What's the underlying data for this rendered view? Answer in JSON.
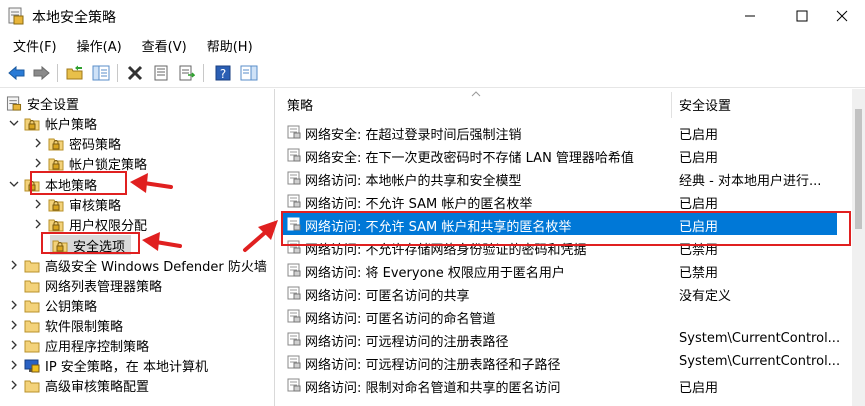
{
  "window": {
    "title": "本地安全策略"
  },
  "menu": [
    "文件(F)",
    "操作(A)",
    "查看(V)",
    "帮助(H)"
  ],
  "toolbar": {
    "buttons": [
      "back-icon",
      "forward-icon",
      "up-folder-icon",
      "show-tree-icon",
      "delete-icon",
      "properties-icon",
      "export-list-icon",
      "help-icon",
      "action-pane-icon"
    ]
  },
  "tree": {
    "root": "安全设置",
    "account_policy": "帐户策略",
    "password_policy": "密码策略",
    "lockout_policy": "帐户锁定策略",
    "local_policy": "本地策略",
    "audit_policy": "审核策略",
    "user_rights": "用户权限分配",
    "security_options": "安全选项",
    "firewall": "高级安全 Windows Defender 防火墙",
    "network_list": "网络列表管理器策略",
    "public_key": "公钥策略",
    "software_restriction": "软件限制策略",
    "app_control": "应用程序控制策略",
    "ip_security": "IP 安全策略，在 本地计算机",
    "advanced_audit": "高级审核策略配置"
  },
  "list": {
    "header_policy": "策略",
    "header_setting": "安全设置",
    "rows": [
      {
        "policy": "网络安全: 在超过登录时间后强制注销",
        "setting": "已启用"
      },
      {
        "policy": "网络安全: 在下一次更改密码时不存储 LAN 管理器哈希值",
        "setting": "已启用"
      },
      {
        "policy": "网络访问: 本地帐户的共享和安全模型",
        "setting": "经典 - 对本地用户进行..."
      },
      {
        "policy": "网络访问: 不允许 SAM 帐户的匿名枚举",
        "setting": "已启用"
      },
      {
        "policy": "网络访问: 不允许 SAM 帐户和共享的匿名枚举",
        "setting": "已启用"
      },
      {
        "policy": "网络访问: 不允许存储网络身份验证的密码和凭据",
        "setting": "已禁用"
      },
      {
        "policy": "网络访问: 将 Everyone 权限应用于匿名用户",
        "setting": "已禁用"
      },
      {
        "policy": "网络访问: 可匿名访问的共享",
        "setting": "没有定义"
      },
      {
        "policy": "网络访问: 可匿名访问的命名管道",
        "setting": ""
      },
      {
        "policy": "网络访问: 可远程访问的注册表路径",
        "setting": "System\\CurrentControl..."
      },
      {
        "policy": "网络访问: 可远程访问的注册表路径和子路径",
        "setting": "System\\CurrentControl..."
      },
      {
        "policy": "网络访问: 限制对命名管道和共享的匿名访问",
        "setting": "已启用"
      }
    ]
  },
  "colors": {
    "selection": "#0078d7",
    "annotation": "#e02020"
  }
}
